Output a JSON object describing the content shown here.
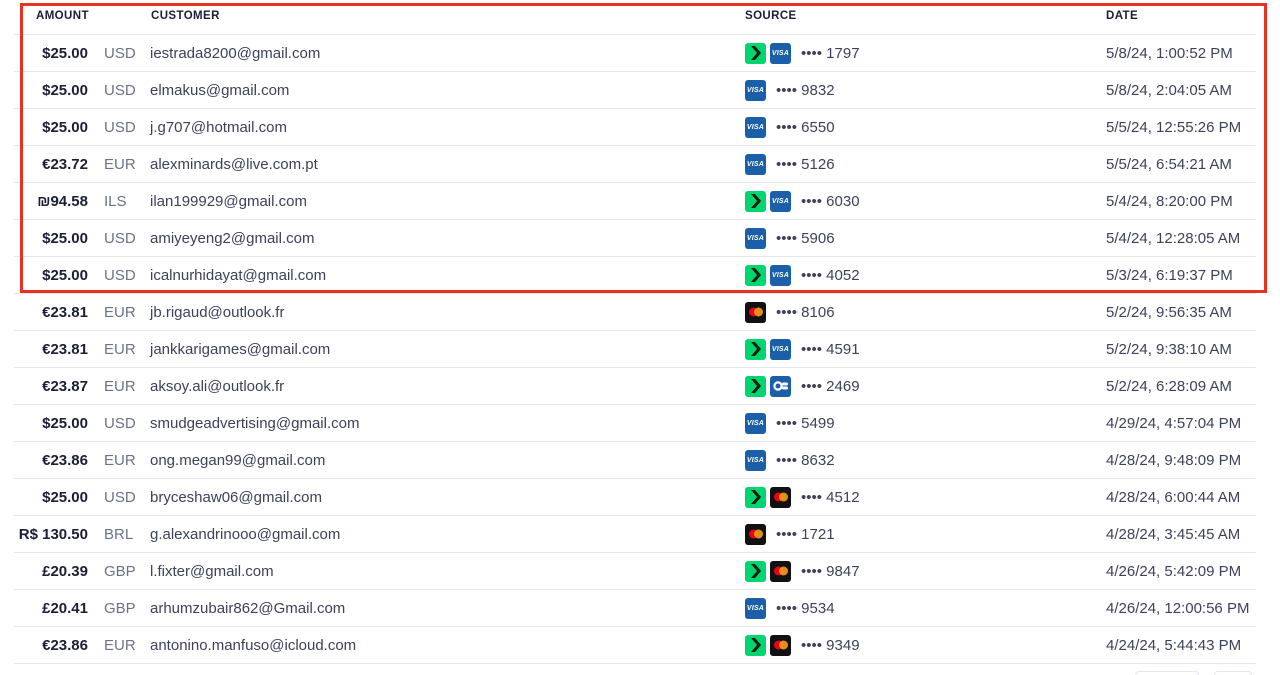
{
  "columns": {
    "amount": "AMOUNT",
    "customer": "CUSTOMER",
    "source": "SOURCE",
    "date": "DATE"
  },
  "colors": {
    "highlight": "#e8311e",
    "link": "#00d66f",
    "visa": "#1a5fa8"
  },
  "rows": [
    {
      "amount": "$25.00",
      "currency": "USD",
      "customer": "iestrada8200@gmail.com",
      "link": true,
      "brand": "visa",
      "last4": "•••• 1797",
      "date": "5/8/24, 1:00:52 PM"
    },
    {
      "amount": "$25.00",
      "currency": "USD",
      "customer": "elmakus@gmail.com",
      "link": false,
      "brand": "visa",
      "last4": "•••• 9832",
      "date": "5/8/24, 2:04:05 AM"
    },
    {
      "amount": "$25.00",
      "currency": "USD",
      "customer": "j.g707@hotmail.com",
      "link": false,
      "brand": "visa",
      "last4": "•••• 6550",
      "date": "5/5/24, 12:55:26 PM"
    },
    {
      "amount": "€23.72",
      "currency": "EUR",
      "customer": "alexminards@live.com.pt",
      "link": false,
      "brand": "visa",
      "last4": "•••• 5126",
      "date": "5/5/24, 6:54:21 AM"
    },
    {
      "amount": "₪94.58",
      "currency": "ILS",
      "customer": "ilan199929@gmail.com",
      "link": true,
      "brand": "visa",
      "last4": "•••• 6030",
      "date": "5/4/24, 8:20:00 PM"
    },
    {
      "amount": "$25.00",
      "currency": "USD",
      "customer": "amiyeyeng2@gmail.com",
      "link": false,
      "brand": "visa",
      "last4": "•••• 5906",
      "date": "5/4/24, 12:28:05 AM"
    },
    {
      "amount": "$25.00",
      "currency": "USD",
      "customer": "icalnurhidayat@gmail.com",
      "link": true,
      "brand": "visa",
      "last4": "•••• 4052",
      "date": "5/3/24, 6:19:37 PM"
    },
    {
      "amount": "€23.81",
      "currency": "EUR",
      "customer": "jb.rigaud@outlook.fr",
      "link": false,
      "brand": "mastercard",
      "last4": "•••• 8106",
      "date": "5/2/24, 9:56:35 AM"
    },
    {
      "amount": "€23.81",
      "currency": "EUR",
      "customer": "jankkarigames@gmail.com",
      "link": true,
      "brand": "visa",
      "last4": "•••• 4591",
      "date": "5/2/24, 9:38:10 AM"
    },
    {
      "amount": "€23.87",
      "currency": "EUR",
      "customer": "aksoy.ali@outlook.fr",
      "link": true,
      "brand": "cartes-bancaires",
      "last4": "•••• 2469",
      "date": "5/2/24, 6:28:09 AM"
    },
    {
      "amount": "$25.00",
      "currency": "USD",
      "customer": "smudgeadvertising@gmail.com",
      "link": false,
      "brand": "visa",
      "last4": "•••• 5499",
      "date": "4/29/24, 4:57:04 PM"
    },
    {
      "amount": "€23.86",
      "currency": "EUR",
      "customer": "ong.megan99@gmail.com",
      "link": false,
      "brand": "visa",
      "last4": "•••• 8632",
      "date": "4/28/24, 9:48:09 PM"
    },
    {
      "amount": "$25.00",
      "currency": "USD",
      "customer": "bryceshaw06@gmail.com",
      "link": true,
      "brand": "mastercard",
      "last4": "•••• 4512",
      "date": "4/28/24, 6:00:44 AM"
    },
    {
      "amount": "R$ 130.50",
      "currency": "BRL",
      "customer": "g.alexandrinooo@gmail.com",
      "link": false,
      "brand": "mastercard",
      "last4": "•••• 1721",
      "date": "4/28/24, 3:45:45 AM"
    },
    {
      "amount": "£20.39",
      "currency": "GBP",
      "customer": "l.fixter@gmail.com",
      "link": true,
      "brand": "mastercard",
      "last4": "•••• 9847",
      "date": "4/26/24, 5:42:09 PM"
    },
    {
      "amount": "£20.41",
      "currency": "GBP",
      "customer": "arhumzubair862@Gmail.com",
      "link": false,
      "brand": "visa",
      "last4": "•••• 9534",
      "date": "4/26/24, 12:00:56 PM"
    },
    {
      "amount": "€23.86",
      "currency": "EUR",
      "customer": "antonino.manfuso@icloud.com",
      "link": true,
      "brand": "mastercard",
      "last4": "•••• 9349",
      "date": "4/24/24, 5:44:43 PM"
    }
  ],
  "brand_labels": {
    "visa": "VISA"
  }
}
